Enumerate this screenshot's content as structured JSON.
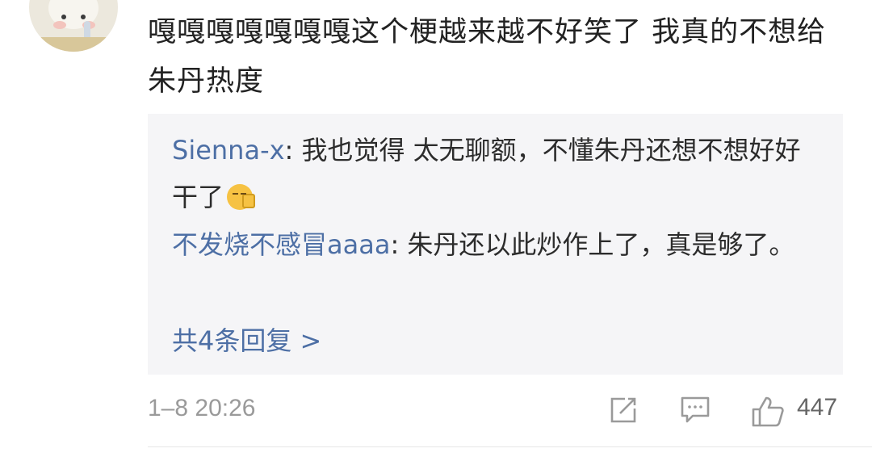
{
  "comment": {
    "text": "嘎嘎嘎嘎嘎嘎嘎这个梗越来越不好笑了  我真的不想给朱丹热度"
  },
  "replies": [
    {
      "user": "Sienna-x",
      "text": "我也觉得  太无聊额，不懂朱丹还想不想好好干了"
    },
    {
      "user": "不发烧不感冒aaaa",
      "text": "朱丹还以此炒作上了，真是够了。"
    }
  ],
  "more_replies": "共4条回复 >",
  "footer": {
    "timestamp": "1–8 20:26",
    "like_count": "447"
  },
  "icons": {
    "share": "share-icon",
    "comment": "comment-icon",
    "like": "like-icon"
  },
  "colors": {
    "username": "#4d6fa5",
    "reply_bg": "#f5f5f7",
    "muted": "#9a9a9a"
  }
}
